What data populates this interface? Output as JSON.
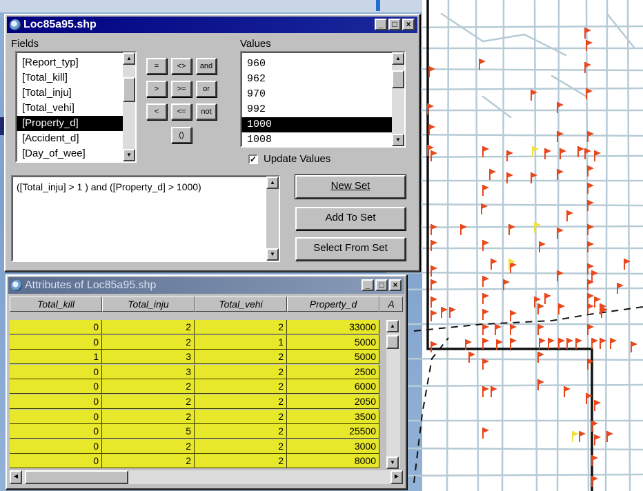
{
  "query_window": {
    "title": "Loc85a95.shp",
    "fields_label": "Fields",
    "fields": [
      "[Report_typ]",
      "[Total_kill]",
      "[Total_inju]",
      "[Total_vehi]",
      "[Property_d]",
      "[Accident_d]",
      "[Day_of_wee]"
    ],
    "fields_selected": "[Property_d]",
    "operators": [
      "=",
      "<>",
      "and",
      ">",
      ">=",
      "or",
      "<",
      "<=",
      "not",
      "()"
    ],
    "values_label": "Values",
    "values": [
      "960",
      "962",
      "970",
      "992",
      "1000",
      "1008"
    ],
    "values_selected": "1000",
    "update_values_label": "Update Values",
    "update_values_checked": true,
    "expression": "([Total_inju] > 1 ) and ([Property_d] > 1000)",
    "new_set_label": "New Set",
    "add_to_set_label": "Add To Set",
    "select_from_set_label": "Select From Set"
  },
  "attributes_window": {
    "title": "Attributes of Loc85a95.shp",
    "columns": [
      "Total_kill",
      "Total_inju",
      "Total_vehi",
      "Property_d",
      "A"
    ],
    "rows": [
      [
        "0",
        "2",
        "2",
        "33000"
      ],
      [
        "0",
        "2",
        "1",
        "5000"
      ],
      [
        "1",
        "3",
        "2",
        "5000"
      ],
      [
        "0",
        "3",
        "2",
        "2500"
      ],
      [
        "0",
        "2",
        "2",
        "6000"
      ],
      [
        "0",
        "2",
        "2",
        "2050"
      ],
      [
        "0",
        "2",
        "2",
        "3500"
      ],
      [
        "0",
        "5",
        "2",
        "25500"
      ],
      [
        "0",
        "2",
        "2",
        "3000"
      ],
      [
        "0",
        "2",
        "2",
        "8000"
      ]
    ],
    "highlight_color": "#e8e82a"
  },
  "map": {
    "road_color": "#b6cbd6",
    "flag_color": "#e8481e",
    "flag_selected_color": "#f0e040"
  }
}
